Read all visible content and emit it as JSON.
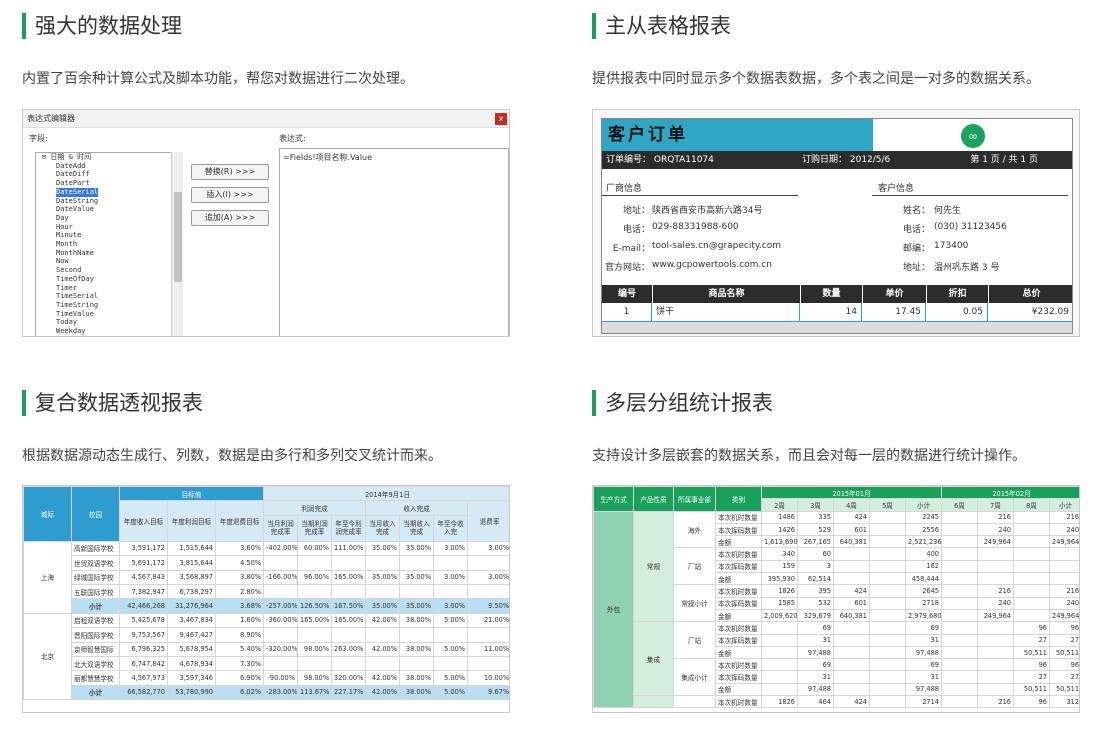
{
  "panels": {
    "p1": {
      "title": "强大的数据处理",
      "desc": "内置了百余种计算公式及脚本功能，帮您对数据进行二次处理。"
    },
    "p2": {
      "title": "主从表格报表",
      "desc": "提供报表中同时显示多个数据表数据，多个表之间是一对多的数据关系。"
    },
    "p3": {
      "title": "复合数据透视报表",
      "desc": "根据数据源动态生成行、列数，数据是由多行和多列交叉统计而来。"
    },
    "p4": {
      "title": "多层分组统计报表",
      "desc": "支持设计多层嵌套的数据关系，而且会对每一层的数据进行统计操作。"
    }
  },
  "editor": {
    "title": "表达式编辑器",
    "close": "x",
    "fields_label": "字段:",
    "expr_label": "表达式:",
    "tree_root": "⊟ 日期 & 时间",
    "tree_items": [
      "DateAdd",
      "DateDiff",
      "DatePart",
      "DateSerial",
      "DateString",
      "DateValue",
      "Day",
      "Hour",
      "Minute",
      "Month",
      "MonthName",
      "Now",
      "Second",
      "TimeOfDay",
      "Timer",
      "TimeSerial",
      "TimeString",
      "TimeValue",
      "Today",
      "Weekday"
    ],
    "selected": "DateSerial",
    "btn_replace": "替换(R) >>>",
    "btn_insert": "插入(I) >>>",
    "btn_append": "追加(A) >>>",
    "expression": "=Fields!项目名称.Value"
  },
  "order": {
    "title": "客户订单",
    "order_no": "订单编号： ORQTA11074",
    "order_date": "订购日期： 2012/5/6",
    "page": "第 1 页 / 共 1 页",
    "vendor_label": "厂商信息",
    "customer_label": "客户信息",
    "vendor": [
      {
        "k": "地址：",
        "v": "陕西省西安市高新六路34号"
      },
      {
        "k": "电话：",
        "v": "029-88331988-600"
      },
      {
        "k": "E-mail：",
        "v": "tool-sales.cn@grapecity.com"
      },
      {
        "k": "官方网站：",
        "v": "www.gcpowertools.com.cn"
      }
    ],
    "customer": [
      {
        "k": "姓名：",
        "v": "何先生"
      },
      {
        "k": "电话：",
        "v": "(030) 31123456"
      },
      {
        "k": "邮编：",
        "v": "173400"
      },
      {
        "k": "地址：",
        "v": "温州巩东路 3 号"
      }
    ],
    "headers": [
      "编号",
      "商品名称",
      "数量",
      "单价",
      "折扣",
      "总价"
    ],
    "row": [
      "1",
      "饼干",
      "14",
      "17.45",
      "0.05",
      "¥232.09"
    ]
  },
  "pivot": {
    "h_region": "城际",
    "h_school": "校园",
    "h_target": "目标值",
    "h_date": "2014年9月1日",
    "h_cols": [
      "年度收入目标",
      "年度利润目标",
      "年度退费目标"
    ],
    "h_profit": "利润完成",
    "h_income": "收入完成",
    "h_refund": "退费率",
    "h_sub": [
      "当月利润完成率",
      "当期利润完成率",
      "年至今利润完成率",
      "当月收入完成",
      "当期收入完成",
      "年至今收入完"
    ],
    "groups": [
      {
        "name": "上海",
        "rows": [
          [
            "高新国际学校",
            "3,591,172",
            "1,515,644",
            "3.60%",
            "-402.00%",
            "60.00%",
            "111.00%",
            "35.00%",
            "35.00%",
            "3.00%",
            "3.00%"
          ],
          [
            "世贸双语学校",
            "5,691,172",
            "3,815,644",
            "4.50%",
            "",
            "",
            "",
            "",
            "",
            "",
            ""
          ],
          [
            "绿城国际学校",
            "4,567,843",
            "3,568,897",
            "3.80%",
            "-166.00%",
            "96.00%",
            "165.00%",
            "35.00%",
            "35.00%",
            "3.00%",
            "3.00%"
          ],
          [
            "五联国际学校",
            "7,382,947",
            "6,738,297",
            "2.80%",
            "",
            "",
            "",
            "",
            "",
            "",
            ""
          ]
        ],
        "total": [
          "小计",
          "42,466,268",
          "31,276,964",
          "3.68%",
          "-257.00%",
          "126.50%",
          "167.50%",
          "35.00%",
          "35.00%",
          "3.00%",
          "9.50%"
        ]
      },
      {
        "name": "北京",
        "rows": [
          [
            "启程双语学校",
            "5,425,678",
            "3,467,834",
            "1.60%",
            "-360.00%",
            "165.00%",
            "165.00%",
            "42.00%",
            "38.00%",
            "5.00%",
            "21.00%"
          ],
          [
            "晋阳国际学校",
            "9,753,567",
            "9,467,427",
            "8.90%",
            "",
            "",
            "",
            "",
            "",
            "",
            ""
          ],
          [
            "京师智慧国际",
            "6,796,325",
            "5,678,954",
            "5.40%",
            "-320.00%",
            "98.00%",
            "263.00%",
            "42.00%",
            "38.00%",
            "5.00%",
            "11.00%"
          ],
          [
            "北大双语学校",
            "6,747,842",
            "4,678,934",
            "7.30%",
            "",
            "",
            "",
            "",
            "",
            "",
            ""
          ],
          [
            "丽都慧慧学校",
            "4,567,973",
            "3,597,346",
            "6.90%",
            "-90.00%",
            "98.00%",
            "320.00%",
            "42.00%",
            "38.00%",
            "5.00%",
            "10.00%"
          ]
        ],
        "total": [
          "小计",
          "66,582,770",
          "53,780,990",
          "6.02%",
          "-283.00%",
          "113.67%",
          "227.17%",
          "42.00%",
          "38.00%",
          "5.00%",
          "9.67%"
        ]
      }
    ]
  },
  "group": {
    "h_mode": "生产方式",
    "h_attr": "产品性质",
    "h_unit": "所属事业部",
    "h_type": "类别",
    "h_month1": "2015年01月",
    "h_month2": "2015年02月",
    "weeks": [
      "2周",
      "3周",
      "4周",
      "5周",
      "小计",
      "6周",
      "7周",
      "8周",
      "小计"
    ],
    "outsource": "外包",
    "rows": [
      {
        "attr": "常规",
        "unit": "海外",
        "type": "本次机时数量",
        "v": [
          "1486",
          "335",
          "424",
          "",
          "2245",
          "",
          "216",
          "",
          "216"
        ]
      },
      {
        "attr": "",
        "unit": "",
        "type": "本次挥码数量",
        "v": [
          "1426",
          "529",
          "601",
          "",
          "2556",
          "",
          "240",
          "",
          "240"
        ]
      },
      {
        "attr": "",
        "unit": "",
        "type": "金额",
        "v": [
          "1,613,690",
          "267,165",
          "640,381",
          "",
          "2,521,236",
          "",
          "249,964",
          "",
          "249,964"
        ]
      },
      {
        "attr": "",
        "unit": "厂站",
        "type": "本次机时数量",
        "v": [
          "340",
          "60",
          "",
          "",
          "400",
          "",
          "",
          "",
          ""
        ]
      },
      {
        "attr": "",
        "unit": "",
        "type": "本次挥码数量",
        "v": [
          "159",
          "3",
          "",
          "",
          "162",
          "",
          "",
          "",
          ""
        ]
      },
      {
        "attr": "",
        "unit": "",
        "type": "金额",
        "v": [
          "395,930",
          "62,514",
          "",
          "",
          "458,444",
          "",
          "",
          "",
          ""
        ]
      },
      {
        "attr": "",
        "unit": "常规小计",
        "type": "本次机时数量",
        "v": [
          "1826",
          "395",
          "424",
          "",
          "2645",
          "",
          "216",
          "",
          "216"
        ]
      },
      {
        "attr": "",
        "unit": "",
        "type": "本次挥码数量",
        "v": [
          "1585",
          "532",
          "601",
          "",
          "2718",
          "",
          "240",
          "",
          "240"
        ]
      },
      {
        "attr": "",
        "unit": "",
        "type": "金额",
        "v": [
          "2,009,620",
          "329,679",
          "640,381",
          "",
          "2,979,680",
          "",
          "249,964",
          "",
          "249,964"
        ]
      },
      {
        "attr": "集成",
        "unit": "厂站",
        "type": "本次机时数量",
        "v": [
          "",
          "69",
          "",
          "",
          "69",
          "",
          "",
          "96",
          "96"
        ]
      },
      {
        "attr": "",
        "unit": "",
        "type": "本次挥码数量",
        "v": [
          "",
          "31",
          "",
          "",
          "31",
          "",
          "",
          "27",
          "27"
        ]
      },
      {
        "attr": "",
        "unit": "",
        "type": "金额",
        "v": [
          "",
          "97,488",
          "",
          "",
          "97,488",
          "",
          "",
          "50,511",
          "50,511"
        ]
      },
      {
        "attr": "",
        "unit": "集成小计",
        "type": "本次机时数量",
        "v": [
          "",
          "69",
          "",
          "",
          "69",
          "",
          "",
          "96",
          "96"
        ]
      },
      {
        "attr": "",
        "unit": "",
        "type": "本次挥码数量",
        "v": [
          "",
          "31",
          "",
          "",
          "31",
          "",
          "",
          "27",
          "27"
        ]
      },
      {
        "attr": "",
        "unit": "",
        "type": "金额",
        "v": [
          "",
          "97,488",
          "",
          "",
          "97,488",
          "",
          "",
          "50,511",
          "50,511"
        ]
      },
      {
        "attr": "",
        "unit": "",
        "type": "本次机时数量",
        "v": [
          "1826",
          "464",
          "424",
          "",
          "2714",
          "",
          "216",
          "96",
          "312"
        ]
      }
    ]
  }
}
